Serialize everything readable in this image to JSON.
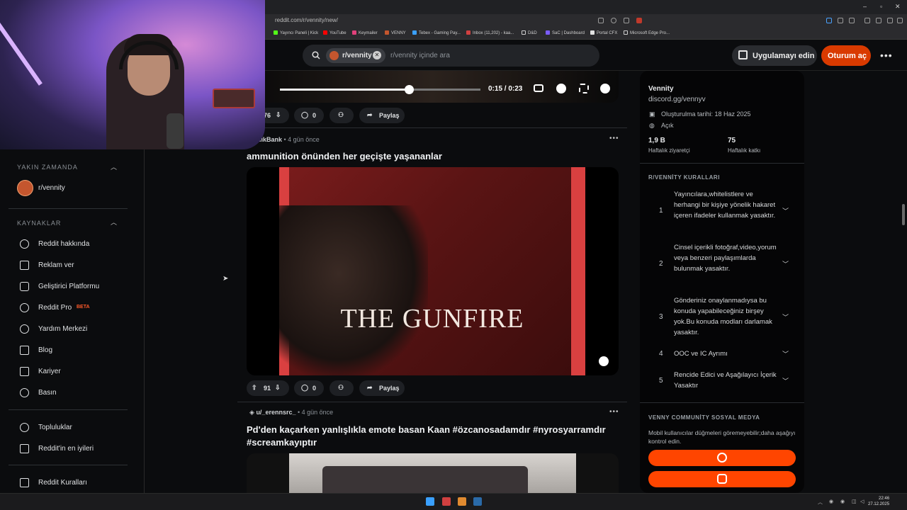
{
  "browser": {
    "url": "reddit.com/r/vennity/new/",
    "bookmarks": [
      "Yayıncı Paneli | Kick",
      "YouTube",
      "Keymailer",
      "VENNY",
      "Tebex - Gaming Pay...",
      "Inbox (11,202) - kaa...",
      "D&D",
      "SaC | Dashboard",
      "Portal CFX",
      "Microsoft Edge Pro..."
    ]
  },
  "header": {
    "subreddit_chip": "r/vennity",
    "search_placeholder": "r/vennity içinde ara",
    "get_app_label": "Uygulamayı edin",
    "login_label": "Oturum aç"
  },
  "sidebar": {
    "recent_title": "YAKIN ZAMANDA",
    "recent_item": "r/vennity",
    "resources_title": "KAYNAKLAR",
    "items": [
      {
        "label": "Reddit hakkında",
        "icon": "reddit-icon"
      },
      {
        "label": "Reklam ver",
        "icon": "megaphone-icon"
      },
      {
        "label": "Geliştirici Platformu",
        "icon": "developer-icon"
      },
      {
        "label": "Reddit Pro",
        "icon": "pro-icon"
      },
      {
        "label": "Yardım Merkezi",
        "icon": "help-icon"
      },
      {
        "label": "Blog",
        "icon": "book-icon"
      },
      {
        "label": "Kariyer",
        "icon": "briefcase-icon"
      },
      {
        "label": "Basın",
        "icon": "mic-icon"
      }
    ],
    "beta_badge": "BETA",
    "communities": "Topluluklar",
    "best_of": "Reddit'in en iyileri",
    "rules": "Reddit Kuralları"
  },
  "feed": {
    "video1": {
      "time": "0:15 / 0:23",
      "score": "76",
      "comments": "0",
      "share": "Paylaş",
      "progress_pct": 64
    },
    "post2": {
      "user": "u/NikBank",
      "age": "4 gün önce",
      "title": "ammunition önünden her geçişte yaşananlar",
      "video_text": "THE GUNFIRE",
      "score": "91",
      "comments": "0",
      "share": "Paylaş"
    },
    "post3": {
      "user": "u/_erennsrc_",
      "age": "4 gün önce",
      "title_line1": "Pd'den kaçarken yanlışlıkla emote basan Kaan #özcanosadamdır #nyrosyarramdır",
      "title_line2": "#screamkayıptır"
    }
  },
  "right_panel": {
    "name": "Vennity",
    "link": "discord.gg/vennyv",
    "created": "Oluşturulma tarihi: 18 Haz 2025",
    "visibility": "Açık",
    "weekly_visitors": "1,9 B",
    "weekly_visitors_label": "Haftalık ziyaretçi",
    "weekly_contrib": "75",
    "weekly_contrib_label": "Haftalık katkı",
    "rules_title": "R/VENNİTY KURALLARI",
    "rules": [
      {
        "n": "1",
        "text": "Yayıncılara,whitelistlere ve herhangi bir kişiye yönelik hakaret içeren ifadeler kullanmak yasaktır."
      },
      {
        "n": "2",
        "text": "Cinsel içerikli fotoğraf,video,yorum veya benzeri paylaşımlarda bulunmak yasaktır."
      },
      {
        "n": "3",
        "text": "Gönderiniz onaylanmadıysa bu konuda yapabileceğiniz birşey yok.Bu konuda modları darlamak yasaktır."
      },
      {
        "n": "4",
        "text": "OOC ve IC Ayrımı"
      },
      {
        "n": "5",
        "text": "Rencide Edici ve Aşağılayıcı İçerik Yasaktır"
      }
    ],
    "social_title": "VENNY COMMUNİTY SOSYAL MEDYA",
    "social_desc": "Mobil kullanıcılar düğmeleri göremeyebilir;daha aşağıyı kontrol edin."
  },
  "taskbar": {
    "time": "22:46",
    "date": "27.12.2025"
  },
  "colors": {
    "accent": "#ff4500",
    "login": "#d93a00"
  }
}
